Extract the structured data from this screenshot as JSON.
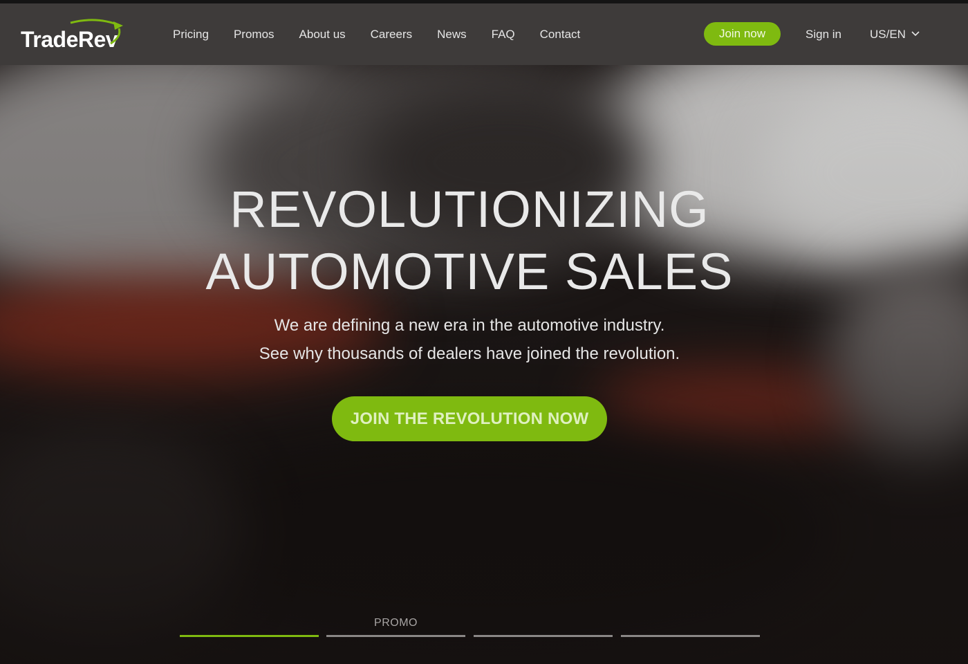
{
  "brand": {
    "name": "TradeRev",
    "accent_color": "#7fba10"
  },
  "nav": {
    "links": [
      "Pricing",
      "Promos",
      "About us",
      "Careers",
      "News",
      "FAQ",
      "Contact"
    ],
    "join_label": "Join now",
    "signin_label": "Sign in",
    "locale_label": "US/EN",
    "locale_icon": "chevron-down-icon"
  },
  "hero": {
    "title_line1": "REVOLUTIONIZING",
    "title_line2": "AUTOMOTIVE SALES",
    "subtitle_line1": "We are defining a new era in the automotive industry.",
    "subtitle_line2": "See why thousands of dealers have joined the revolution.",
    "cta_label": "JOIN THE REVOLUTION NOW"
  },
  "slider": {
    "tabs": [
      {
        "label": "",
        "active": true
      },
      {
        "label": "PROMO",
        "active": false
      },
      {
        "label": "",
        "active": false
      },
      {
        "label": "",
        "active": false
      }
    ]
  }
}
